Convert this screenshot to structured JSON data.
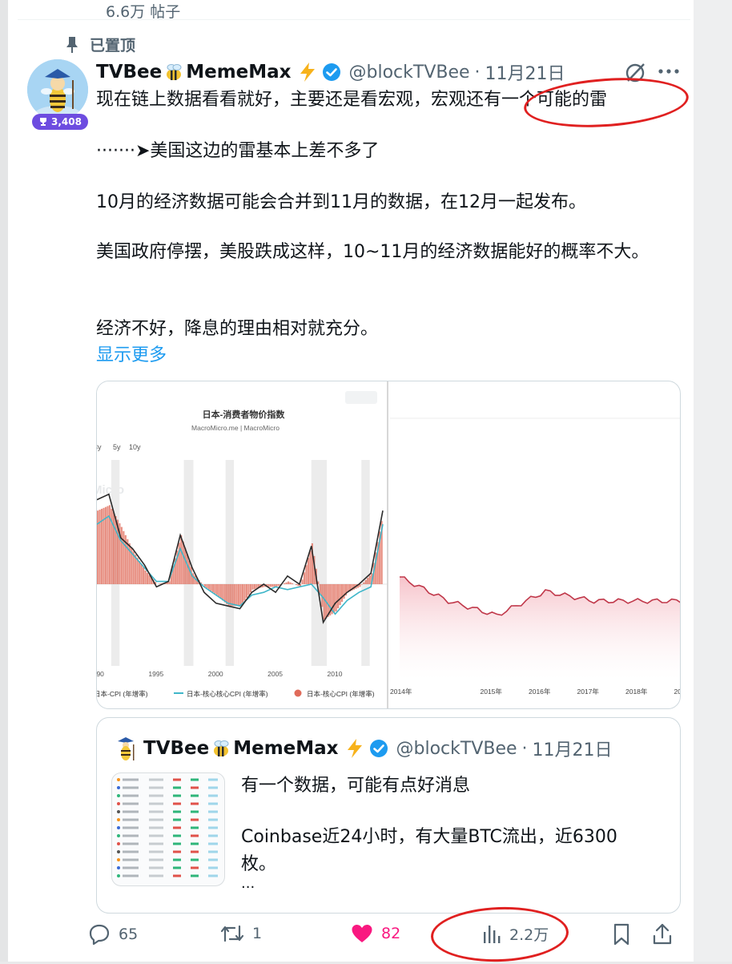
{
  "profile": {
    "posts_count": "6.6万 帖子"
  },
  "post": {
    "pinned_label": "已置顶",
    "author_name_a": "TVBee",
    "author_name_b": "MemeMax",
    "handle": "@blockTVBee",
    "date": "11月21日",
    "reputation": "3,408",
    "paragraphs": [
      "现在链上数据看看就好，主要还是看宏观，宏观还有一个可能的雷",
      "·······➤美国这边的雷基本上差不多了",
      "10月的经济数据可能会合并到11月的数据，在12月一起发布。",
      "美国政府停摆，美股跌成这样，10~11月的经济数据能好的概率不大。",
      "经济不好，降息的理由相对就充分。"
    ],
    "show_more": "显示更多"
  },
  "chart_left": {
    "title": "日本-消费者物价指数",
    "subtitle": "MacroMicro.me | MacroMicro",
    "range_buttons": [
      "3y",
      "5y",
      "10y"
    ],
    "watermark": "Micro",
    "x_ticks": [
      "1990",
      "1995",
      "2000",
      "2005",
      "2010"
    ],
    "legend": [
      "日本-CPI (年增率)",
      "日本-核心核心CPI (年增率)",
      "日本-核心CPI (年增率)"
    ],
    "colors": {
      "cpi": "#2b2b2b",
      "core_core": "#3fb6c9",
      "core": "#e06b5a"
    }
  },
  "chart_right": {
    "x_ticks": [
      "2014年",
      "2015年",
      "2016年",
      "2017年",
      "2018年",
      "2019年",
      "2020"
    ],
    "color": "#c0384a"
  },
  "chart_data": [
    {
      "type": "line",
      "title": "日本-消费者物价指数",
      "x": [
        1990,
        1991,
        1992,
        1993,
        1994,
        1995,
        1996,
        1997,
        1998,
        1999,
        2000,
        2001,
        2002,
        2003,
        2004,
        2005,
        2006,
        2007,
        2008,
        2009,
        2010,
        2011,
        2012,
        2013,
        2014
      ],
      "series": [
        {
          "name": "日本-CPI (年增率)",
          "values": [
            3.1,
            3.3,
            1.7,
            1.3,
            0.7,
            -0.1,
            0.1,
            1.8,
            0.6,
            -0.3,
            -0.7,
            -0.8,
            -0.9,
            -0.3,
            0.0,
            -0.3,
            0.3,
            0.0,
            1.4,
            -1.4,
            -0.7,
            -0.3,
            0.0,
            0.4,
            2.7
          ]
        },
        {
          "name": "日本-核心核心CPI (年增率)",
          "values": [
            2.2,
            2.5,
            1.6,
            1.1,
            0.6,
            0.1,
            0.1,
            1.3,
            0.3,
            -0.1,
            -0.4,
            -0.7,
            -0.8,
            -0.4,
            -0.3,
            -0.1,
            -0.2,
            -0.1,
            0.0,
            -0.5,
            -1.1,
            -0.6,
            -0.3,
            -0.1,
            2.2
          ]
        },
        {
          "name": "日本-核心CPI (年增率)",
          "values": [
            2.7,
            2.9,
            2.1,
            1.2,
            0.5,
            0.0,
            0.1,
            1.8,
            0.4,
            -0.1,
            -0.4,
            -0.8,
            -0.8,
            -0.2,
            -0.1,
            -0.1,
            0.1,
            -0.1,
            1.5,
            -1.3,
            -1.0,
            -0.3,
            -0.1,
            0.4,
            2.7
          ]
        }
      ]
    },
    {
      "type": "area",
      "x": [
        2014,
        2015,
        2016,
        2017,
        2018,
        2019,
        2020
      ],
      "series": [
        {
          "values": [
            0.6,
            0.1,
            -0.2,
            0.3,
            0.1,
            0.1,
            0.1
          ]
        }
      ]
    }
  ],
  "quote": {
    "author_name_a": "TVBee",
    "author_name_b": "MemeMax",
    "handle": "@blockTVBee",
    "date": "11月21日",
    "lines": [
      "有一个数据，可能有点好消息",
      "Coinbase近24小时，有大量BTC流出，近6300枚。",
      "..."
    ]
  },
  "actions": {
    "replies": "65",
    "reposts": "1",
    "likes": "82",
    "views": "2.2万"
  },
  "colors": {
    "link": "#1d9bf0",
    "like": "#f91880",
    "verified": "#1d9bf0",
    "annotation": "#e02020"
  }
}
